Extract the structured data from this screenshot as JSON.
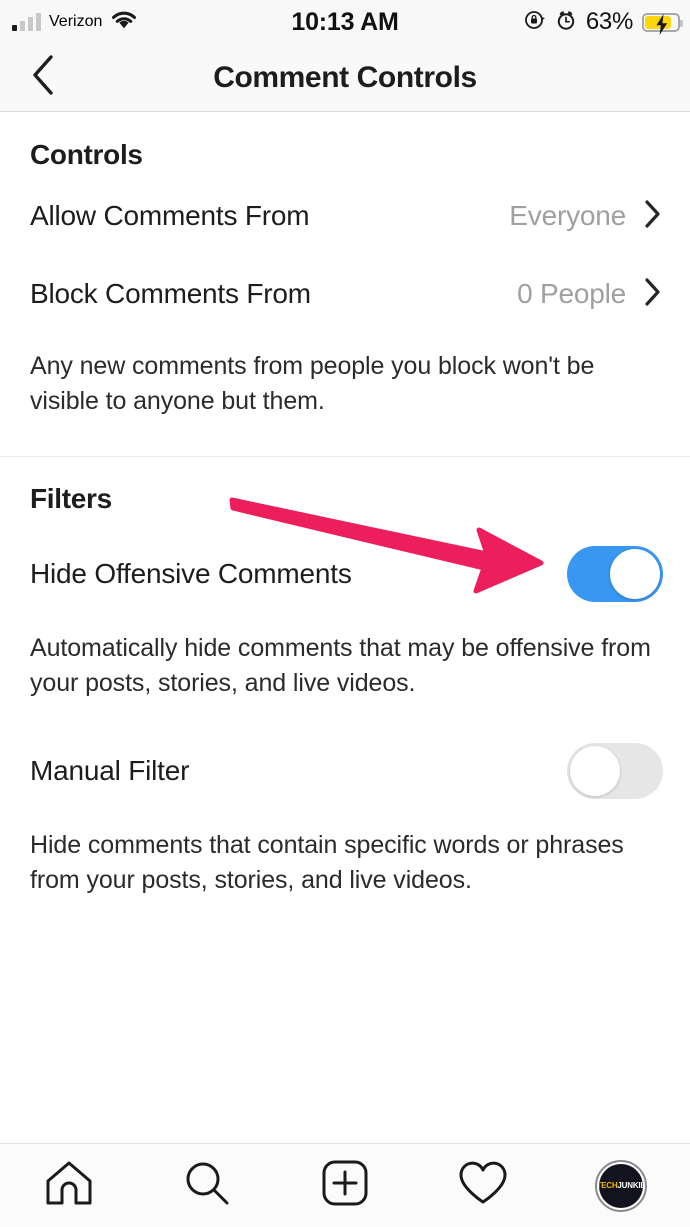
{
  "status_bar": {
    "carrier": "Verizon",
    "time": "10:13 AM",
    "battery_percent": "63%",
    "signal_icon": "signal-bars-icon",
    "wifi_icon": "wifi-icon",
    "rotation_lock_icon": "rotation-lock-icon",
    "alarm_icon": "alarm-clock-icon",
    "battery_icon": "battery-charging-icon"
  },
  "header": {
    "title": "Comment Controls",
    "back_icon": "chevron-left-icon"
  },
  "sections": {
    "controls": {
      "title": "Controls",
      "rows": [
        {
          "label": "Allow Comments From",
          "value": "Everyone",
          "chevron": "chevron-right-icon"
        },
        {
          "label": "Block Comments From",
          "value": "0 People",
          "chevron": "chevron-right-icon"
        }
      ],
      "helper": "Any new comments from people you block won't be visible to anyone but them."
    },
    "filters": {
      "title": "Filters",
      "items": [
        {
          "label": "Hide Offensive Comments",
          "toggle_state": "on",
          "helper": "Automatically hide comments that may be offensive from your posts, stories, and live videos."
        },
        {
          "label": "Manual Filter",
          "toggle_state": "off",
          "helper": "Hide comments that contain specific words or phrases from your posts, stories, and live videos."
        }
      ]
    }
  },
  "annotation": {
    "type": "arrow",
    "color": "#ED1E5C",
    "points_to": "hide-offensive-comments-toggle"
  },
  "tab_bar": {
    "items": [
      {
        "name": "home-icon",
        "label": "Home"
      },
      {
        "name": "search-icon",
        "label": "Search"
      },
      {
        "name": "add-post-icon",
        "label": "New Post"
      },
      {
        "name": "activity-heart-icon",
        "label": "Activity"
      },
      {
        "name": "profile-avatar",
        "label": "Profile"
      }
    ],
    "avatar_text_primary": "TECH",
    "avatar_text_secondary": "JUNKIE"
  },
  "colors": {
    "toggle_on": "#3897F0",
    "toggle_off": "#E6E6E6",
    "battery": "#FFD60A",
    "annotation": "#ED1E5C",
    "text_primary": "#1D1D1D",
    "text_muted": "#A0A0A0"
  }
}
